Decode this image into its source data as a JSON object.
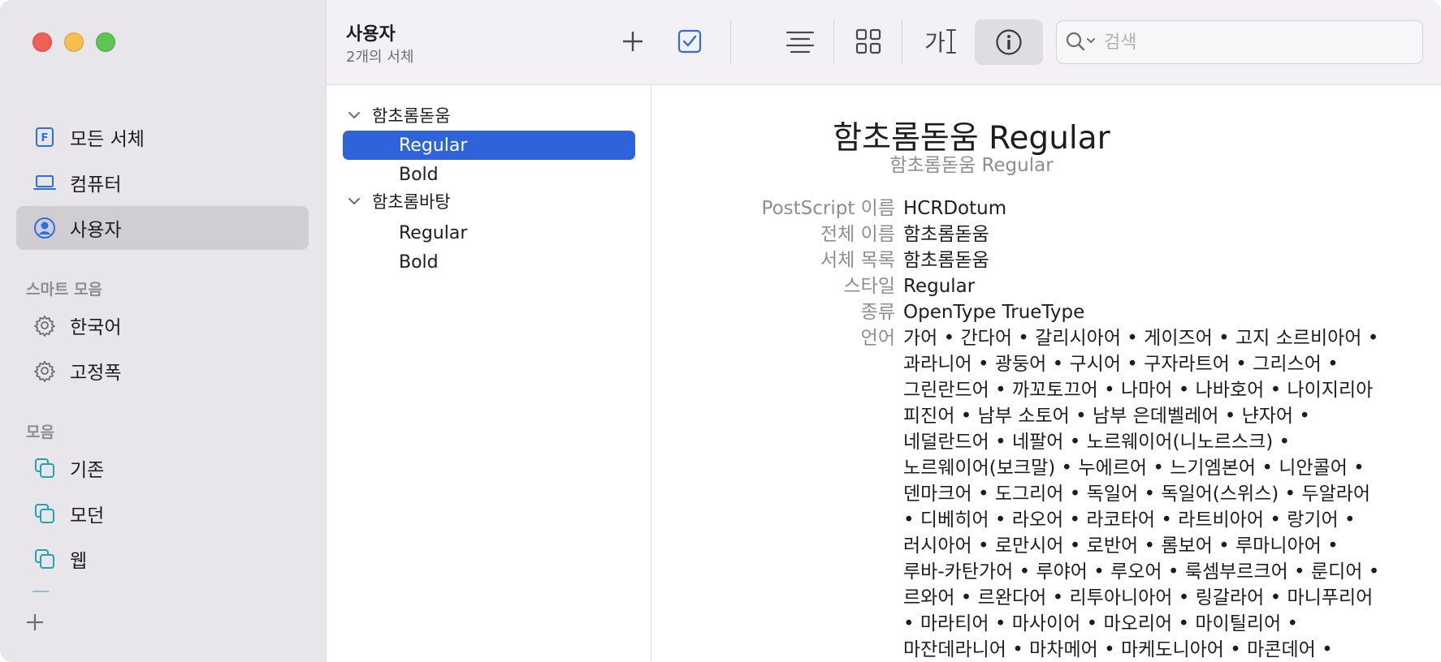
{
  "sidebar": {
    "library_items": [
      {
        "label": "모든 서체",
        "icon": "font-file-icon"
      },
      {
        "label": "컴퓨터",
        "icon": "laptop-icon"
      },
      {
        "label": "사용자",
        "icon": "user-circle-icon",
        "selected": true
      }
    ],
    "smart_section": "스마트 모음",
    "smart_items": [
      {
        "label": "한국어",
        "icon": "gear-icon"
      },
      {
        "label": "고정폭",
        "icon": "gear-icon"
      }
    ],
    "collection_section": "모음",
    "collection_items": [
      {
        "label": "기존",
        "icon": "collection-icon"
      },
      {
        "label": "모던",
        "icon": "collection-icon"
      },
      {
        "label": "웹",
        "icon": "collection-icon"
      }
    ]
  },
  "toolbar": {
    "title": "사용자",
    "subtitle": "2개의 서체",
    "search_placeholder": "검색",
    "sample_glyph": "가"
  },
  "font_list": {
    "families": [
      {
        "name": "함초롬돋움",
        "faces": [
          {
            "name": "Regular",
            "selected": true
          },
          {
            "name": "Bold"
          }
        ]
      },
      {
        "name": "함초롬바탕",
        "faces": [
          {
            "name": "Regular"
          },
          {
            "name": "Bold"
          }
        ]
      }
    ]
  },
  "detail": {
    "title": "함초롬돋움 Regular",
    "subtitle": "함초롬돋움 Regular",
    "rows": [
      {
        "key": "PostScript 이름",
        "value": "HCRDotum"
      },
      {
        "key": "전체 이름",
        "value": "함초롬돋움"
      },
      {
        "key": "서체 목록",
        "value": "함초롬돋움"
      },
      {
        "key": "스타일",
        "value": "Regular"
      },
      {
        "key": "종류",
        "value": "OpenType TrueType"
      }
    ],
    "language_key": "언어",
    "language_lines": [
      "가어 • 간다어 • 갈리시아어 • 게이즈어 • 고지 소르비아어 •",
      "과라니어 • 광둥어 • 구시어 • 구자라트어 • 그리스어 •",
      "그린란드어 • 까꼬토끄어 • 나마어 • 나바호어 • 나이지리아",
      "피진어 • 남부 소토어 • 남부 은데벨레어 • 냔자어 •",
      "네덜란드어 • 네팔어 • 노르웨이어(니노르스크) •",
      "노르웨이어(보크말) • 누에르어 • 느기엠본어 • 니안콜어 •",
      "덴마크어 • 도그리어 • 독일어 • 독일어(스위스) • 두알라어",
      "• 디베히어 • 라오어 • 라코타어 • 라트비아어 • 랑기어 •",
      "러시아어 • 로만시어 • 로반어 • 롬보어 • 루마니아어 •",
      "루바-카탄가어 • 루야어 • 루오어 • 룩셈부르크어 • 룬디어 •",
      "르와어 • 르완다어 • 리투아니아어 • 링갈라어 • 마니푸리어",
      "• 마라티어 • 마사이어 • 마오리어 • 마이틸리어 •",
      "마잔데라니어 • 마차메어 • 마케도니아어 • 마콘데어 •"
    ]
  }
}
